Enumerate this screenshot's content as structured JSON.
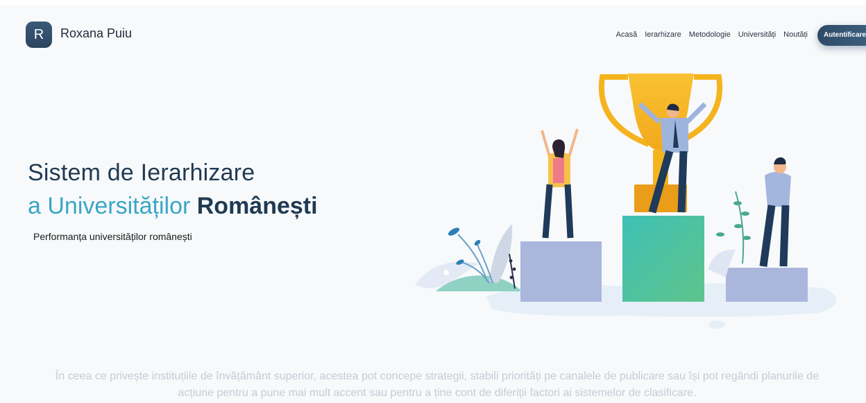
{
  "header": {
    "logo_letter": "R",
    "brand": "Roxana Puiu",
    "nav": [
      "Acasă",
      "Ierarhizare",
      "Metodologie",
      "Universități",
      "Noutăți"
    ],
    "login": "Autentificare"
  },
  "hero": {
    "title_line1": "Sistem de Ierarhizare",
    "title_line2_prefix": "a Universităților ",
    "title_line2_bold": "Românești",
    "subtitle": "Performanța universităților românești"
  },
  "intro": {
    "text": "În ceea ce privește instituțiile de învățământ superior, acestea pot concepe strategii, stabili priorități pe canalele de publicare sau își pot regândi planurile de acțiune pentru a pune mai mult accent sau pentru a ține cont de diferiții factori ai sistemelor de clasificare."
  },
  "colors": {
    "primary": "#1f3a52",
    "accent": "#3aa6c4",
    "podium_center": "#4ec3a3",
    "podium_side": "#aab6dc",
    "trophy": "#f5b41e"
  },
  "illustration": {
    "name": "podium-trophy-illustration"
  }
}
